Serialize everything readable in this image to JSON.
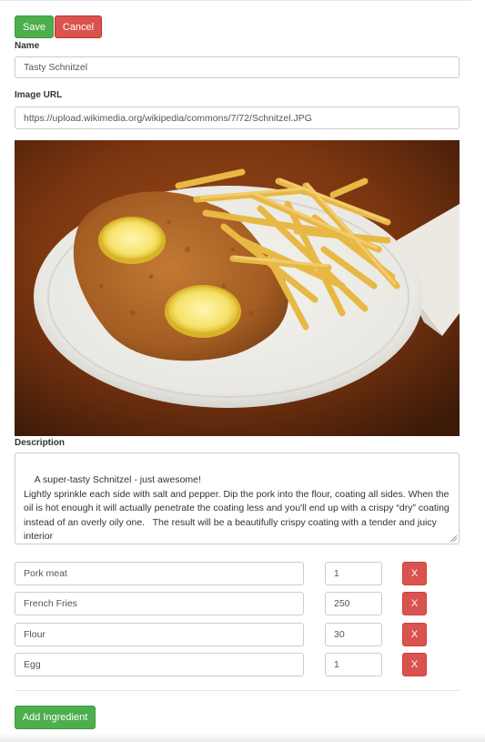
{
  "toolbar": {
    "save_label": "Save",
    "cancel_label": "Cancel"
  },
  "form": {
    "name_label": "Name",
    "name_value": "Tasty Schnitzel",
    "image_url_label": "Image URL",
    "image_url_value": "https://upload.wikimedia.org/wikipedia/commons/7/72/Schnitzel.JPG",
    "description_label": "Description",
    "description_value": "A super-tasty Schnitzel - just awesome!\nLightly sprinkle each side with salt and pepper. Dip the pork into the flour, coating all sides. When the oil is hot enough it will actually penetrate the coating less and you'll end up with a crispy “dry” coating instead of an overly oily one.   The result will be a beautifully crispy coating with a tender and juicy interior"
  },
  "ingredients": [
    {
      "name": "Pork meat",
      "amount": "1",
      "delete_label": "X"
    },
    {
      "name": "French Fries",
      "amount": "250",
      "delete_label": "X"
    },
    {
      "name": "Flour",
      "amount": "30",
      "delete_label": "X"
    },
    {
      "name": "Egg",
      "amount": "1",
      "delete_label": "X"
    }
  ],
  "add_ingredient_label": "Add Ingredient",
  "colors": {
    "success": "#4cae4c",
    "danger": "#d9534f",
    "border": "#cccccc"
  }
}
